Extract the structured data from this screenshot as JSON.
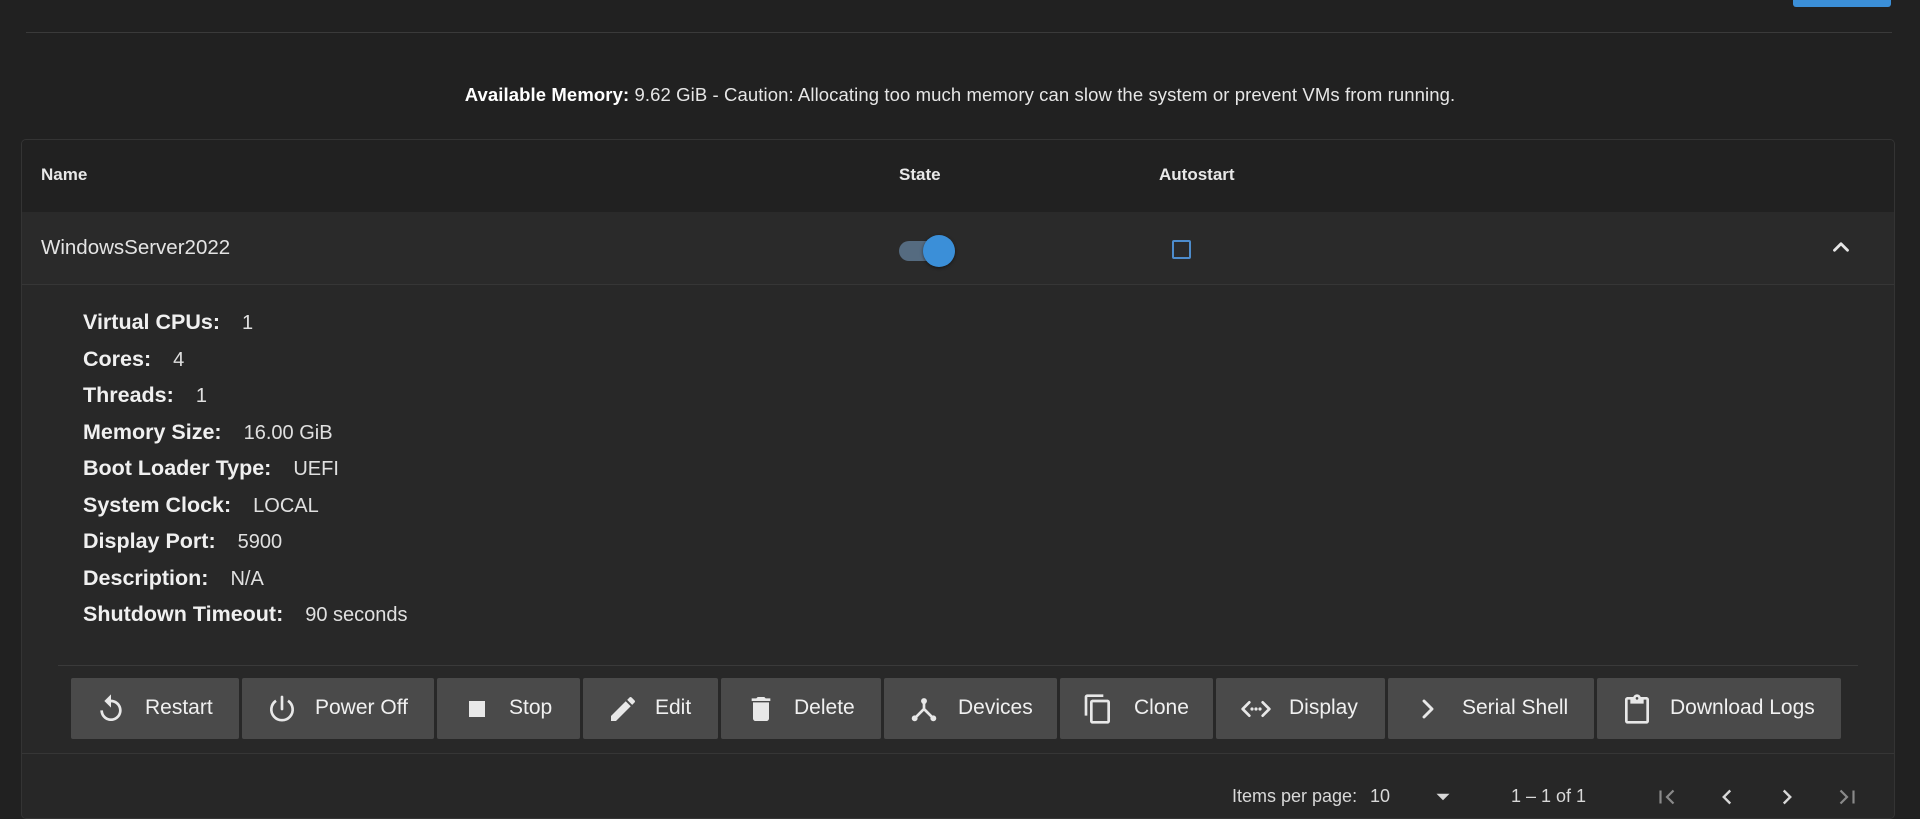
{
  "memory": {
    "label": "Available Memory:",
    "text": "9.62 GiB - Caution: Allocating too much memory can slow the system or prevent VMs from running."
  },
  "table": {
    "columns": [
      "Name",
      "State",
      "Autostart"
    ]
  },
  "vm": {
    "name": "WindowsServer2022",
    "state_on": true,
    "autostart": false,
    "details": [
      {
        "label": "Virtual CPUs:",
        "value": "1"
      },
      {
        "label": "Cores:",
        "value": "4"
      },
      {
        "label": "Threads:",
        "value": "1"
      },
      {
        "label": "Memory Size:",
        "value": "16.00 GiB"
      },
      {
        "label": "Boot Loader Type:",
        "value": "UEFI"
      },
      {
        "label": "System Clock:",
        "value": "LOCAL"
      },
      {
        "label": "Display Port:",
        "value": "5900"
      },
      {
        "label": "Description:",
        "value": "N/A"
      },
      {
        "label": "Shutdown Timeout:",
        "value": "90 seconds"
      }
    ]
  },
  "actions": [
    {
      "label": "Restart",
      "icon": "restart-icon"
    },
    {
      "label": "Power Off",
      "icon": "power-icon"
    },
    {
      "label": "Stop",
      "icon": "stop-icon"
    },
    {
      "label": "Edit",
      "icon": "pencil-icon"
    },
    {
      "label": "Delete",
      "icon": "trash-icon"
    },
    {
      "label": "Devices",
      "icon": "devices-icon"
    },
    {
      "label": "Clone",
      "icon": "clone-icon"
    },
    {
      "label": "Display",
      "icon": "display-icon"
    },
    {
      "label": "Serial Shell",
      "icon": "chevron-right-icon"
    },
    {
      "label": "Download Logs",
      "icon": "clipboard-icon"
    }
  ],
  "pagination": {
    "items_per_page_label": "Items per page:",
    "items_per_page": "10",
    "range": "1 – 1 of 1"
  },
  "colors": {
    "accent": "#3b8fd8",
    "background": "#212121",
    "button": "#4a4a4a"
  }
}
